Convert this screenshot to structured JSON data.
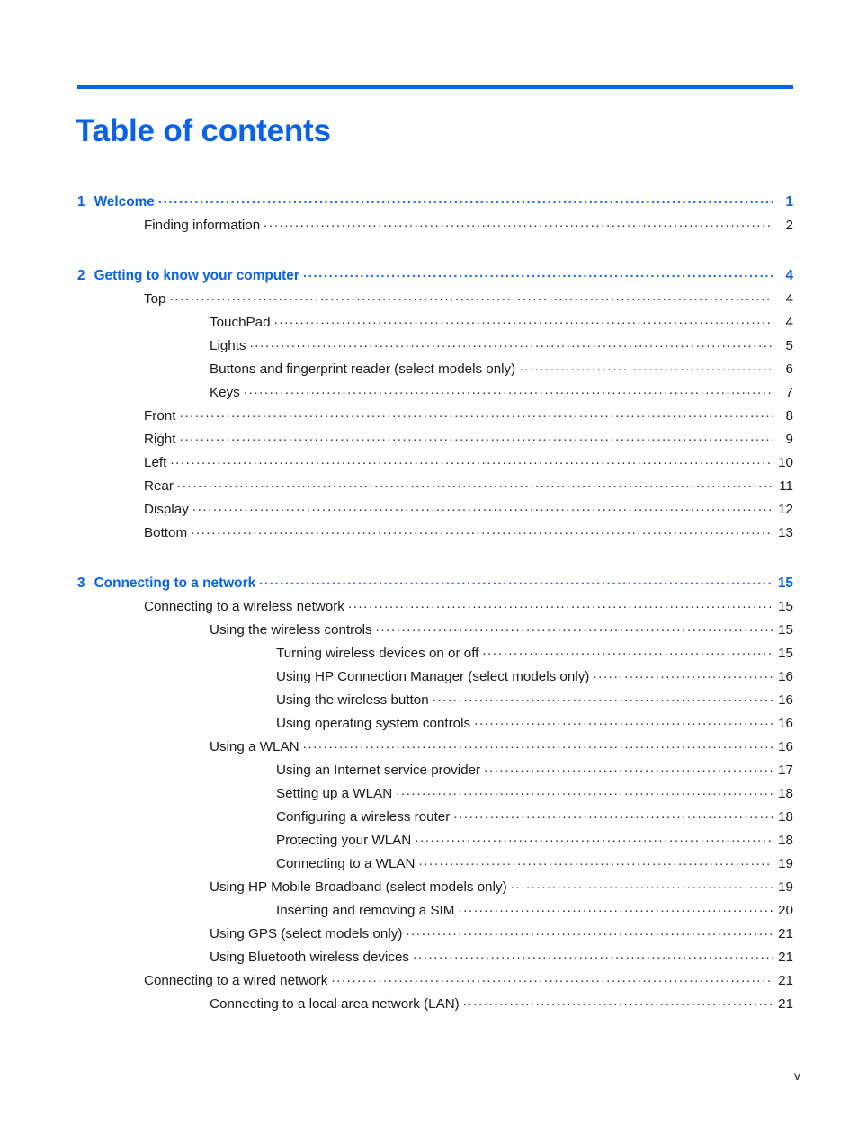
{
  "document": {
    "title": "Table of contents",
    "accent_color": "#0a62e8",
    "text_color": "#1a1a1a",
    "folio": "v"
  },
  "toc": {
    "entries": [
      {
        "level": "chapter",
        "number": "1",
        "label": "Welcome",
        "page": "1"
      },
      {
        "level": "1",
        "number": "",
        "label": "Finding information",
        "page": "2"
      },
      {
        "level": "chapter",
        "number": "2",
        "label": "Getting to know your computer",
        "page": "4"
      },
      {
        "level": "1",
        "number": "",
        "label": "Top",
        "page": "4"
      },
      {
        "level": "2",
        "number": "",
        "label": "TouchPad",
        "page": "4"
      },
      {
        "level": "2",
        "number": "",
        "label": "Lights",
        "page": "5"
      },
      {
        "level": "2",
        "number": "",
        "label": "Buttons and fingerprint reader (select models only)",
        "page": "6"
      },
      {
        "level": "2",
        "number": "",
        "label": "Keys",
        "page": "7"
      },
      {
        "level": "1",
        "number": "",
        "label": "Front",
        "page": "8"
      },
      {
        "level": "1",
        "number": "",
        "label": "Right",
        "page": "9"
      },
      {
        "level": "1",
        "number": "",
        "label": "Left",
        "page": "10"
      },
      {
        "level": "1",
        "number": "",
        "label": "Rear",
        "page": "11"
      },
      {
        "level": "1",
        "number": "",
        "label": "Display",
        "page": "12"
      },
      {
        "level": "1",
        "number": "",
        "label": "Bottom",
        "page": "13"
      },
      {
        "level": "chapter",
        "number": "3",
        "label": "Connecting to a network",
        "page": "15"
      },
      {
        "level": "1",
        "number": "",
        "label": "Connecting to a wireless network",
        "page": "15"
      },
      {
        "level": "2",
        "number": "",
        "label": "Using the wireless controls",
        "page": "15"
      },
      {
        "level": "3",
        "number": "",
        "label": "Turning wireless devices on or off",
        "page": "15"
      },
      {
        "level": "3",
        "number": "",
        "label": "Using HP Connection Manager (select models only)",
        "page": "16"
      },
      {
        "level": "3",
        "number": "",
        "label": "Using the wireless button",
        "page": "16"
      },
      {
        "level": "3",
        "number": "",
        "label": "Using operating system controls",
        "page": "16"
      },
      {
        "level": "2",
        "number": "",
        "label": "Using a WLAN",
        "page": "16"
      },
      {
        "level": "3",
        "number": "",
        "label": "Using an Internet service provider",
        "page": "17"
      },
      {
        "level": "3",
        "number": "",
        "label": "Setting up a WLAN",
        "page": "18"
      },
      {
        "level": "3",
        "number": "",
        "label": "Configuring a wireless router",
        "page": "18"
      },
      {
        "level": "3",
        "number": "",
        "label": "Protecting your WLAN",
        "page": "18"
      },
      {
        "level": "3",
        "number": "",
        "label": "Connecting to a WLAN",
        "page": "19"
      },
      {
        "level": "2",
        "number": "",
        "label": "Using HP Mobile Broadband (select models only)",
        "page": "19"
      },
      {
        "level": "3",
        "number": "",
        "label": "Inserting and removing a SIM",
        "page": "20"
      },
      {
        "level": "2",
        "number": "",
        "label": "Using GPS (select models only)",
        "page": "21"
      },
      {
        "level": "2",
        "number": "",
        "label": "Using Bluetooth wireless devices",
        "page": "21"
      },
      {
        "level": "1",
        "number": "",
        "label": "Connecting to a wired network",
        "page": "21"
      },
      {
        "level": "2",
        "number": "",
        "label": "Connecting to a local area network (LAN)",
        "page": "21"
      }
    ]
  }
}
